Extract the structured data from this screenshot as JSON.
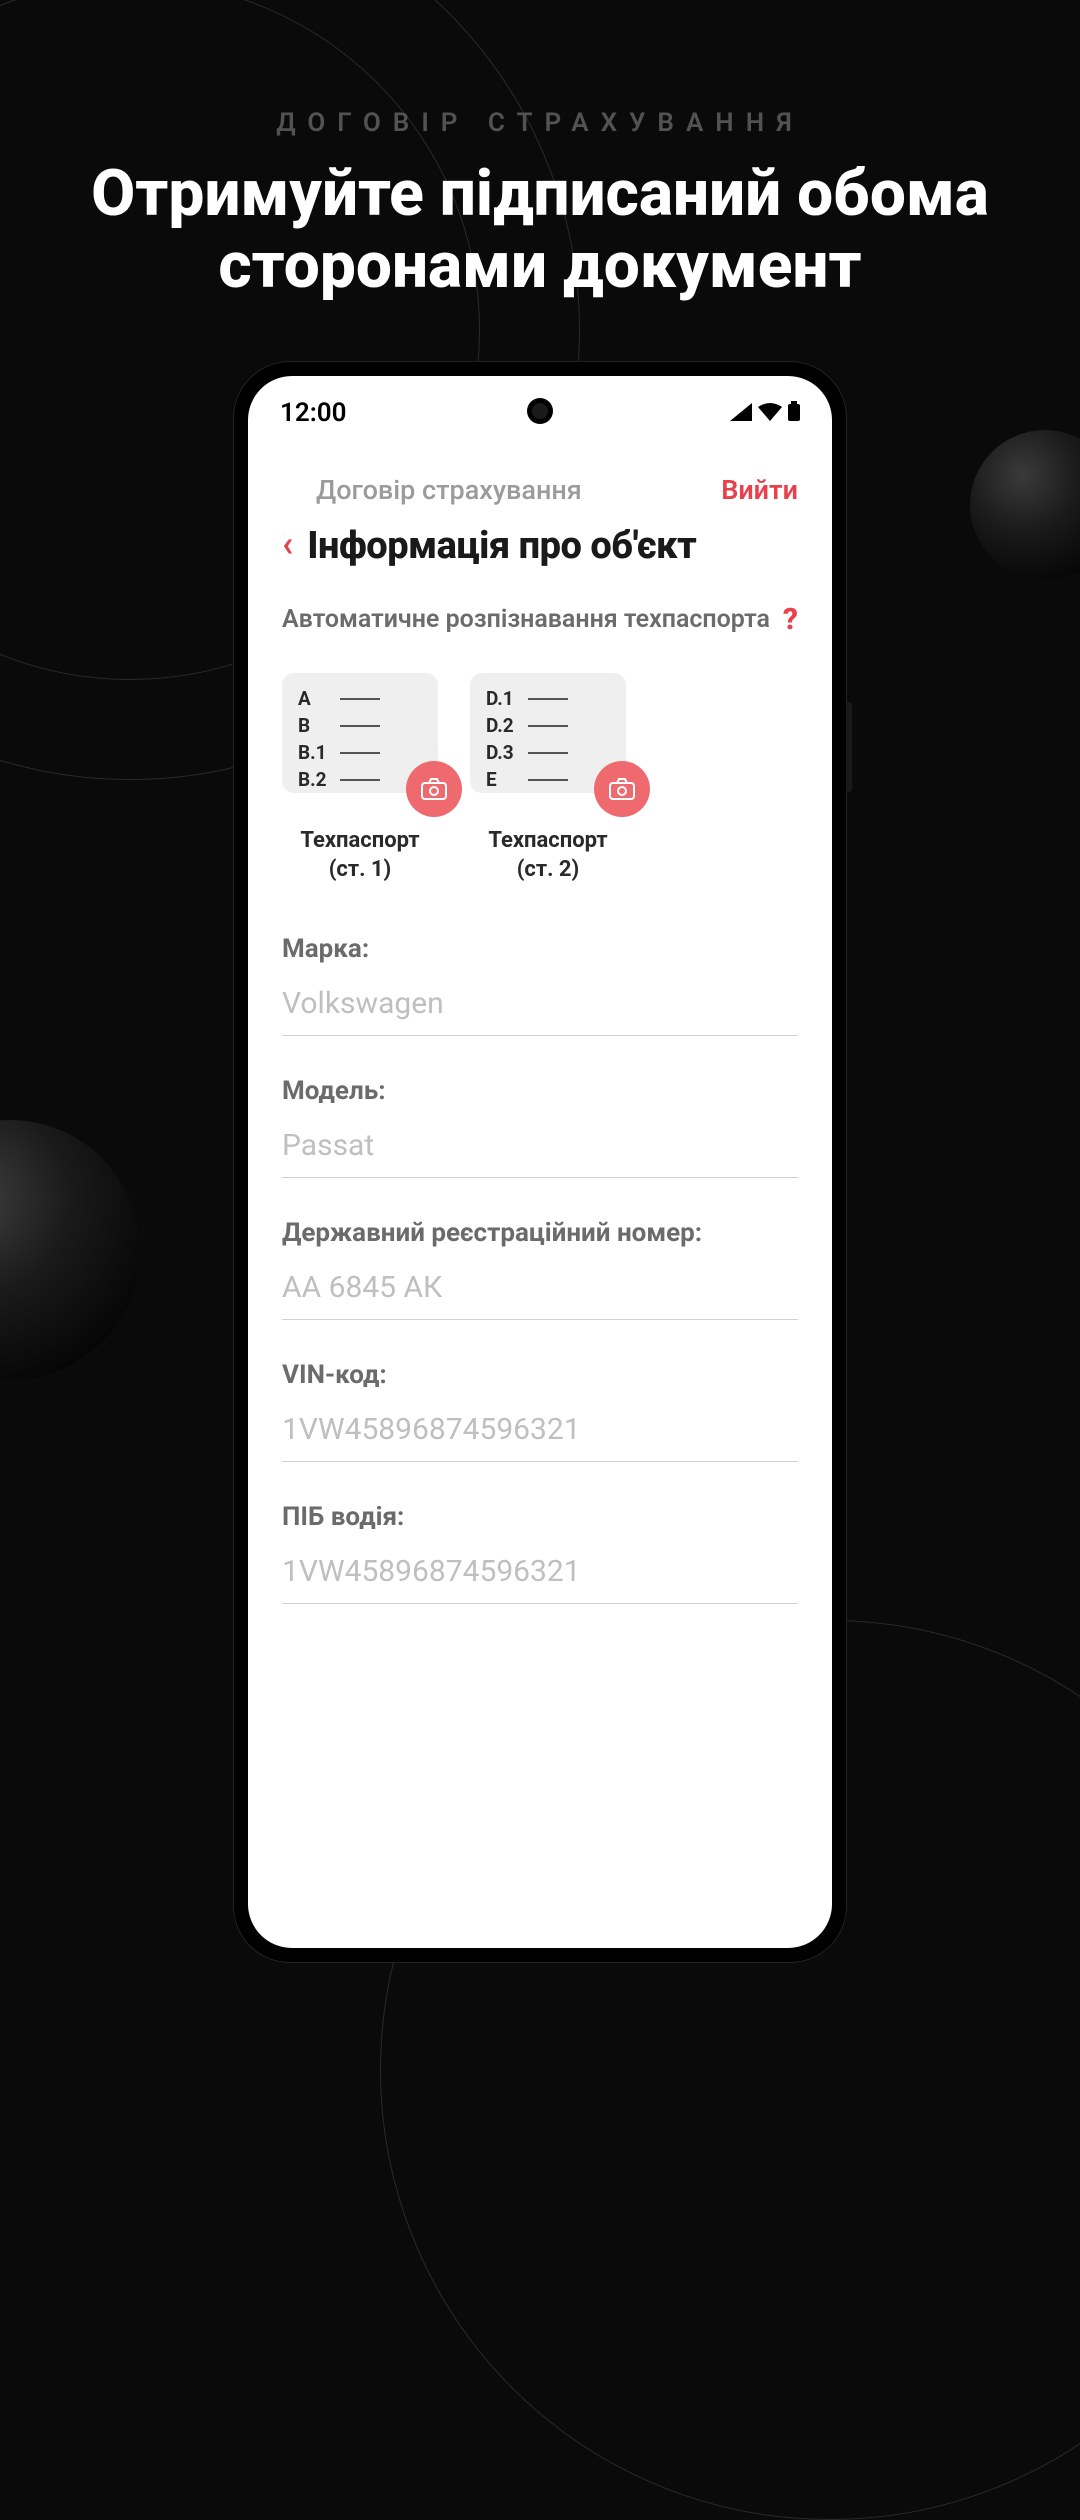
{
  "marketing": {
    "eyebrow": "ДОГОВІР СТРАХУВАННЯ",
    "headline": "Отримуйте підписаний обома сторонами документ"
  },
  "statusbar": {
    "time": "12:00"
  },
  "app": {
    "breadcrumb": "Договір страхування",
    "exit": "Вийти",
    "title": "Інформація про об'єкт",
    "section_label": "Автоматичне розпізнавання техпаспорта",
    "help_glyph": "?",
    "uploaders": [
      {
        "keys": [
          "A",
          "B",
          "B.1",
          "B.2"
        ],
        "caption_l1": "Техпаспорт",
        "caption_l2": "(ст. 1)"
      },
      {
        "keys": [
          "D.1",
          "D.2",
          "D.3",
          "E"
        ],
        "caption_l1": "Техпаспорт",
        "caption_l2": "(ст. 2)"
      }
    ],
    "fields": [
      {
        "label": "Марка:",
        "value": "Volkswagen"
      },
      {
        "label": "Модель:",
        "value": "Passat"
      },
      {
        "label": "Державний реєстраційний номер:",
        "value": "АА 6845 АК"
      },
      {
        "label": "VIN-код:",
        "value": "1VW45896874596321"
      },
      {
        "label": "ПІБ водія:",
        "value": "1VW45896874596321"
      }
    ]
  }
}
